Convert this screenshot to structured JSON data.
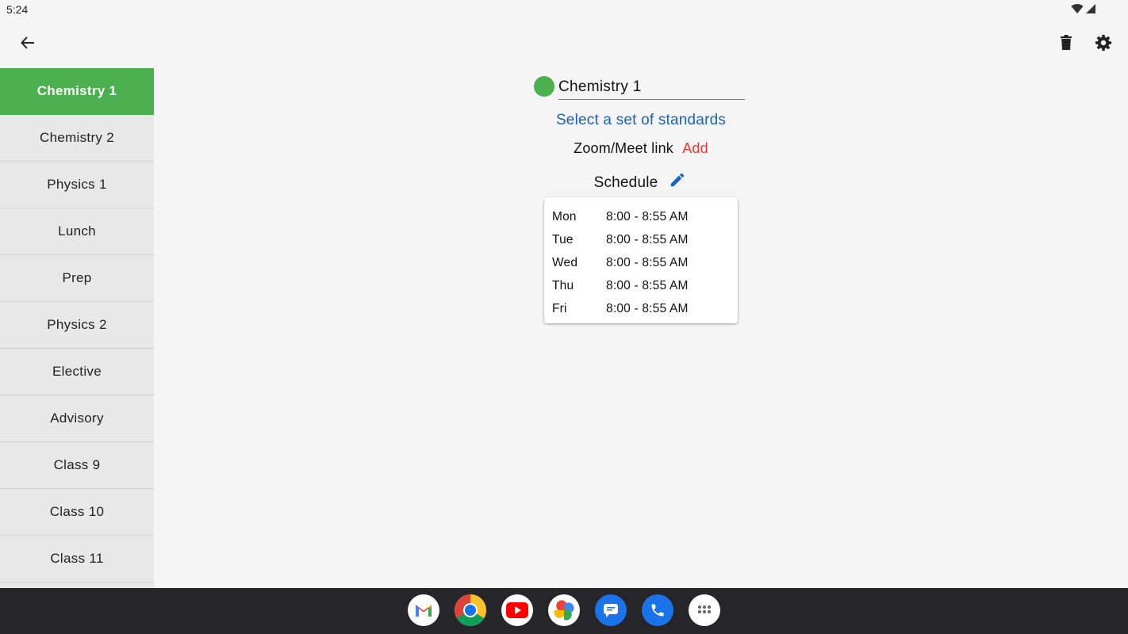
{
  "status_bar": {
    "time": "5:24"
  },
  "sidebar": {
    "items": [
      {
        "label": "Chemistry 1",
        "active": true
      },
      {
        "label": "Chemistry 2"
      },
      {
        "label": "Physics 1"
      },
      {
        "label": "Lunch"
      },
      {
        "label": "Prep"
      },
      {
        "label": "Physics 2"
      },
      {
        "label": "Elective"
      },
      {
        "label": "Advisory"
      },
      {
        "label": "Class 9"
      },
      {
        "label": "Class 10"
      },
      {
        "label": "Class 11"
      }
    ]
  },
  "class_detail": {
    "name": "Chemistry 1",
    "color": "#4caf50",
    "standards_link": "Select a set of standards",
    "zoom_label": "Zoom/Meet link",
    "zoom_action": "Add",
    "schedule_title": "Schedule",
    "schedule": [
      {
        "day": "Mon",
        "time": "8:00 - 8:55 AM"
      },
      {
        "day": "Tue",
        "time": "8:00 - 8:55 AM"
      },
      {
        "day": "Wed",
        "time": "8:00 - 8:55 AM"
      },
      {
        "day": "Thu",
        "time": "8:00 - 8:55 AM"
      },
      {
        "day": "Fri",
        "time": "8:00 - 8:55 AM"
      }
    ]
  },
  "colors": {
    "accent_green": "#4caf50",
    "link_blue": "#1565c0",
    "add_red": "#e53935"
  },
  "icons": {
    "app_bar": [
      "back-arrow-icon",
      "delete-icon",
      "settings-icon"
    ],
    "dock": [
      "gmail-icon",
      "chrome-icon",
      "youtube-icon",
      "photos-icon",
      "messages-icon",
      "phone-icon",
      "app-drawer-icon"
    ]
  }
}
